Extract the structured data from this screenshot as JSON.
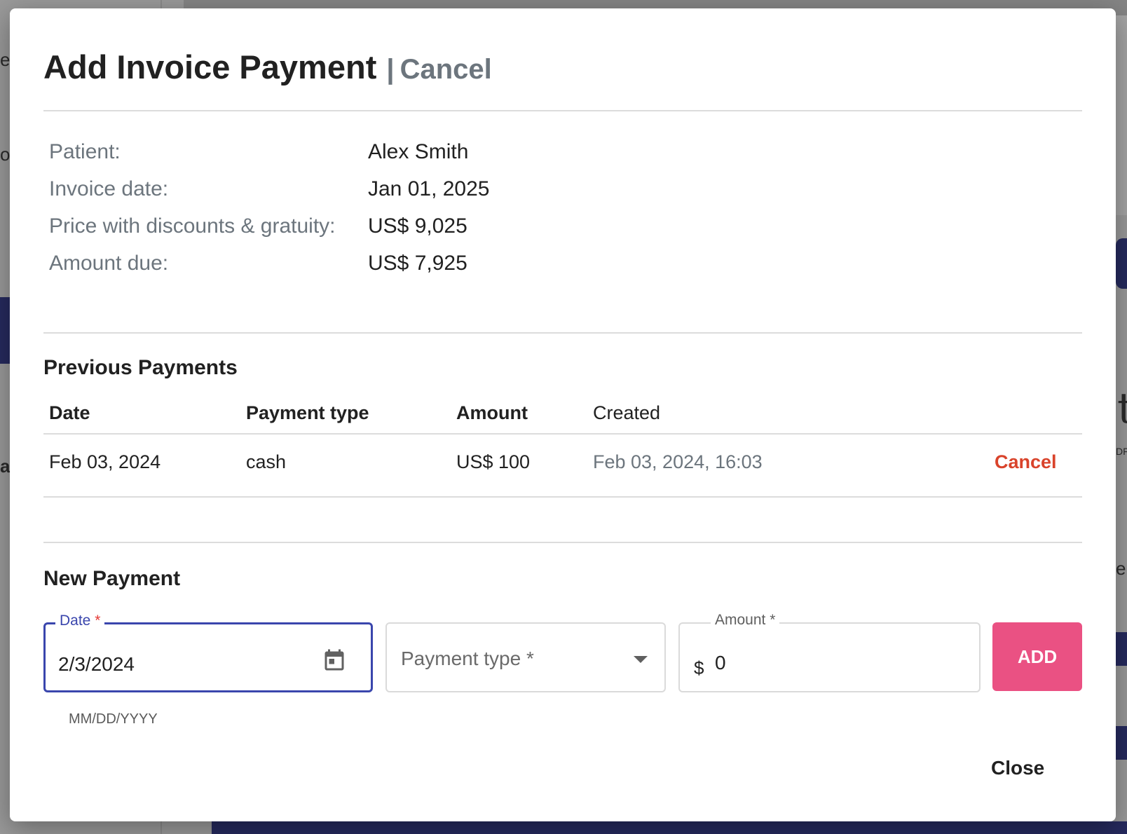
{
  "background": {
    "fragments": [
      "ea",
      "o",
      "al",
      "e",
      "t",
      "DF"
    ]
  },
  "modal": {
    "title": "Add Invoice Payment",
    "title_separator": "|",
    "title_cancel_label": "Cancel",
    "info": {
      "patient_label": "Patient:",
      "patient_value": "Alex Smith",
      "invoice_date_label": "Invoice date:",
      "invoice_date_value": "Jan 01, 2025",
      "price_label": "Price with discounts & gratuity:",
      "price_value": "US$ 9,025",
      "amount_due_label": "Amount due:",
      "amount_due_value": "US$ 7,925"
    },
    "previous_payments": {
      "title": "Previous Payments",
      "columns": [
        "Date",
        "Payment type",
        "Amount",
        "Created"
      ],
      "rows": [
        {
          "date": "Feb 03, 2024",
          "payment_type": "cash",
          "amount": "US$ 100",
          "created": "Feb 03, 2024, 16:03",
          "action_label": "Cancel"
        }
      ]
    },
    "new_payment": {
      "title": "New Payment",
      "date_label": "Date",
      "required_marker": "*",
      "date_value": "2/3/2024",
      "date_helper": "MM/DD/YYYY",
      "payment_type_placeholder": "Payment type *",
      "amount_label": "Amount *",
      "currency_symbol": "$",
      "amount_value": "0",
      "add_label": "ADD"
    },
    "close_label": "Close"
  },
  "colors": {
    "accent_focus": "#3a46ad",
    "add_button": "#ea5183",
    "cancel_red": "#d9432b",
    "navy_background": "#262a5e"
  },
  "icons": {
    "calendar": "calendar-icon",
    "dropdown": "caret-down-icon"
  }
}
